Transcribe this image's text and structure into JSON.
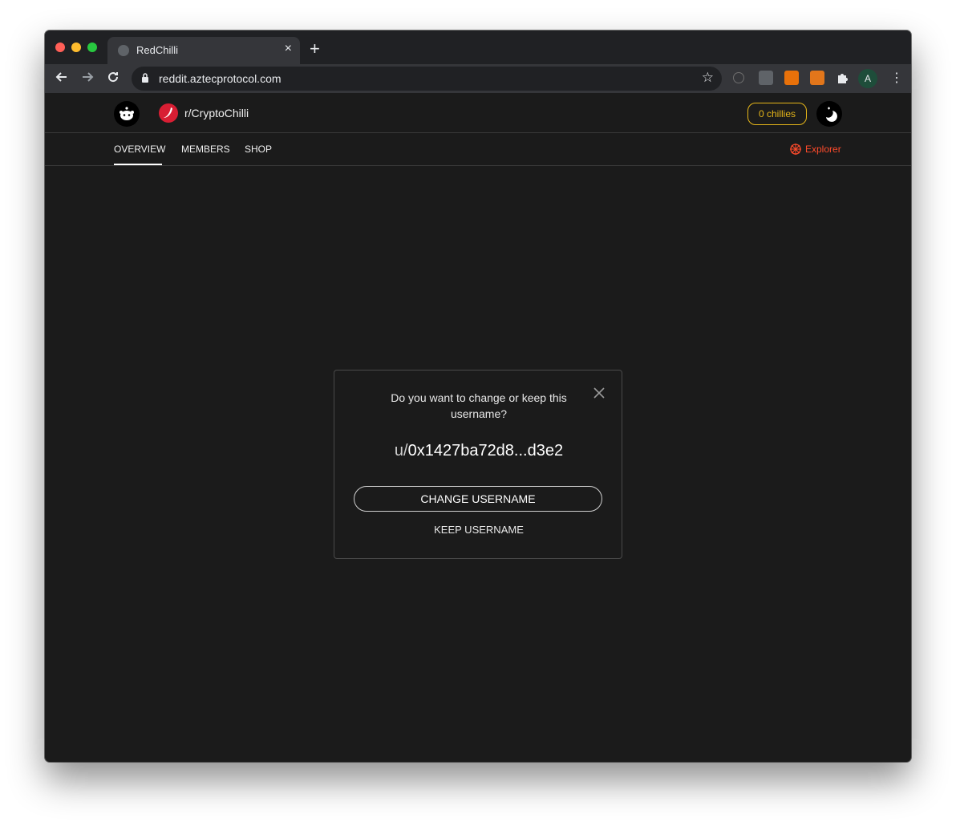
{
  "browser": {
    "tab_title": "RedChilli",
    "tab_close": "×",
    "new_tab": "+",
    "url": "reddit.aztecprotocol.com",
    "profile_initial": "A",
    "traffic_lights": [
      "#ff5f57",
      "#febc2e",
      "#28c840"
    ]
  },
  "header": {
    "subreddit": "r/CryptoChilli",
    "chillies": "0 chillies"
  },
  "nav": {
    "items": [
      "OVERVIEW",
      "MEMBERS",
      "SHOP"
    ],
    "active": "OVERVIEW",
    "explorer": "Explorer"
  },
  "modal": {
    "question": "Do you want to change or keep this username?",
    "prefix": "u/",
    "username": "0x1427ba72d8...d3e2",
    "change_label": "CHANGE USERNAME",
    "keep_label": "KEEP USERNAME"
  },
  "colors": {
    "page_bg": "#1b1b1b",
    "accent_yellow": "#e6b619",
    "accent_red": "#ff4b2b",
    "chili_red": "#d81e33"
  }
}
